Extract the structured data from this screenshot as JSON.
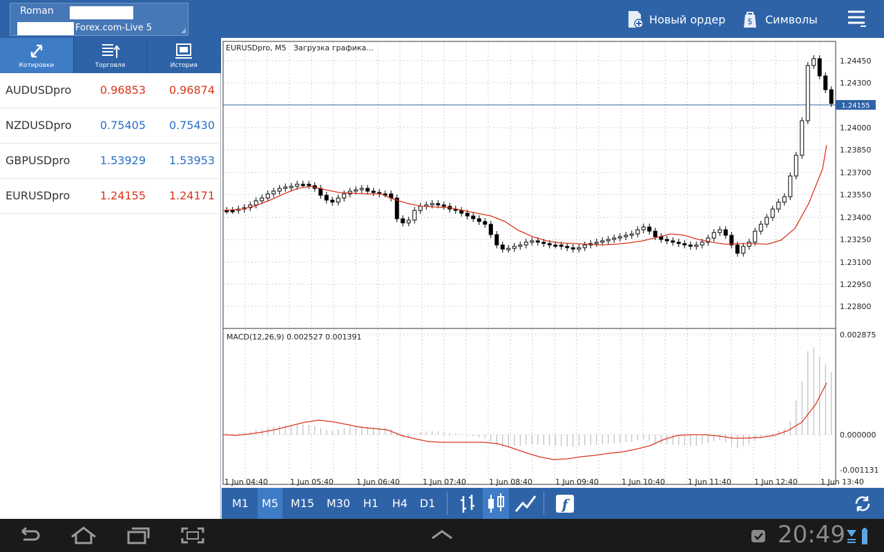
{
  "topbar": {
    "account_name": "Roman",
    "server": "Forex.com-Live 5",
    "new_order": "Новый ордер",
    "symbols": "Символы"
  },
  "tabs": [
    {
      "label": "Котировки",
      "icon": "arrows-icon"
    },
    {
      "label": "Торговля",
      "icon": "trade-list-icon"
    },
    {
      "label": "История",
      "icon": "history-icon"
    }
  ],
  "quotes": [
    {
      "symbol": "AUDUSDpro",
      "bid": "0.96853",
      "ask": "0.96874",
      "color": "#d9341c"
    },
    {
      "symbol": "NZDUSDpro",
      "bid": "0.75405",
      "ask": "0.75430",
      "color": "#2a6fc9"
    },
    {
      "symbol": "GBPUSDpro",
      "bid": "1.53929",
      "ask": "1.53953",
      "color": "#2a6fc9"
    },
    {
      "symbol": "EURUSDpro",
      "bid": "1.24155",
      "ask": "1.24171",
      "color": "#d9341c"
    }
  ],
  "chart": {
    "header": "EURUSDpro, M5",
    "loading": "Загрузка графика...",
    "current_price": "1.24155",
    "price_labels": [
      "1.24450",
      "1.24300",
      "1.24000",
      "1.23850",
      "1.23700",
      "1.23550",
      "1.23400",
      "1.23250",
      "1.23100",
      "1.22950",
      "1.22800"
    ],
    "macd_title": "MACD(12,26,9) 0.002527 0.001391",
    "macd_labels": [
      "0.002875",
      "0.000000",
      "-0.001131"
    ],
    "time_labels": [
      "1 Jun 04:40",
      "1 Jun 05:40",
      "1 Jun 06:40",
      "1 Jun 07:40",
      "1 Jun 08:40",
      "1 Jun 09:40",
      "1 Jun 10:40",
      "1 Jun 11:40",
      "1 Jun 12:40",
      "1 Jun 13:40"
    ]
  },
  "timeframes": [
    "M1",
    "M5",
    "M15",
    "M30",
    "H1",
    "H4",
    "D1"
  ],
  "active_timeframe": "M5",
  "status": {
    "clock": "20:49"
  }
}
